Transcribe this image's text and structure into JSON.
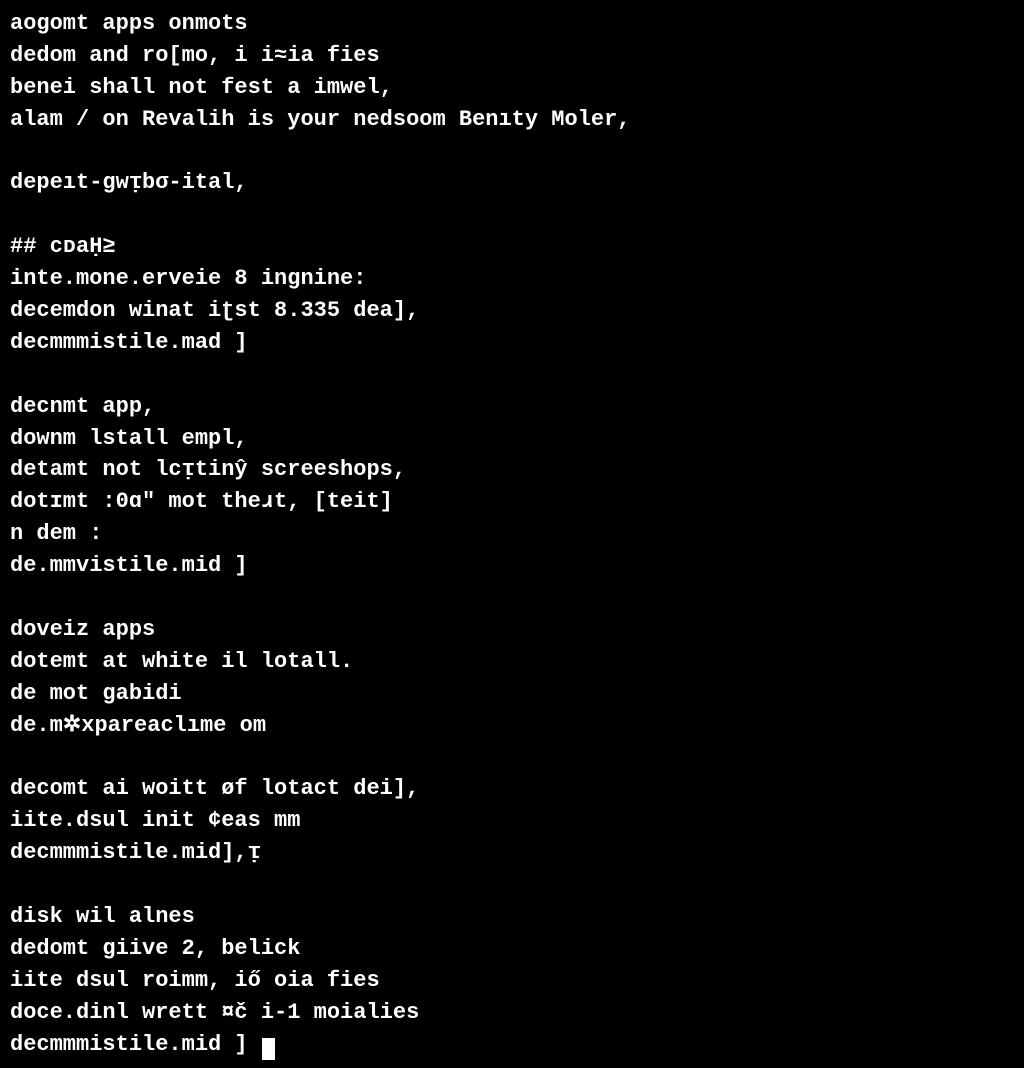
{
  "terminal": {
    "lines": [
      "aogomt apps onmots",
      "dedom and ro[mo, i i≈ia fies",
      "benei shall not fest a imwel,",
      "alam / on Revalih is your nedsoom Benıty Moler,",
      "",
      "depeıt-gwᴉbσ-ital,",
      "",
      "## cᴅaḤ≥",
      "inte.mone.erveie 8 ingnine:",
      "decemdon winat iʈst 8.335 dea],",
      "decmmmistile.mad ]",
      "",
      "decnmt app,",
      "downm lstall empl,",
      "detamt not lcᴉtinŷ screeshops,",
      "dotɪmt :0ɑ\" mot theɹt, [teit]",
      "n dem :",
      "de.mmvistile.mid ]",
      "",
      "doveiz apps",
      "dotemt at white il lotall.",
      "de mot gabidi",
      "de.m✲xpareaclıme om",
      "",
      "decomt ai woitt øf lotact dei],",
      "iite.dsul init ¢eas mm",
      "decmmmistile.mid],ᴉ",
      "",
      "disk wil alnes",
      "dedomt giive 2, belick",
      "iite dsul roimm, iő oia fies",
      "doce.dinl wrett ¤č i-1 moialies",
      "decmmmistile.mid ] "
    ],
    "has_cursor": true
  }
}
